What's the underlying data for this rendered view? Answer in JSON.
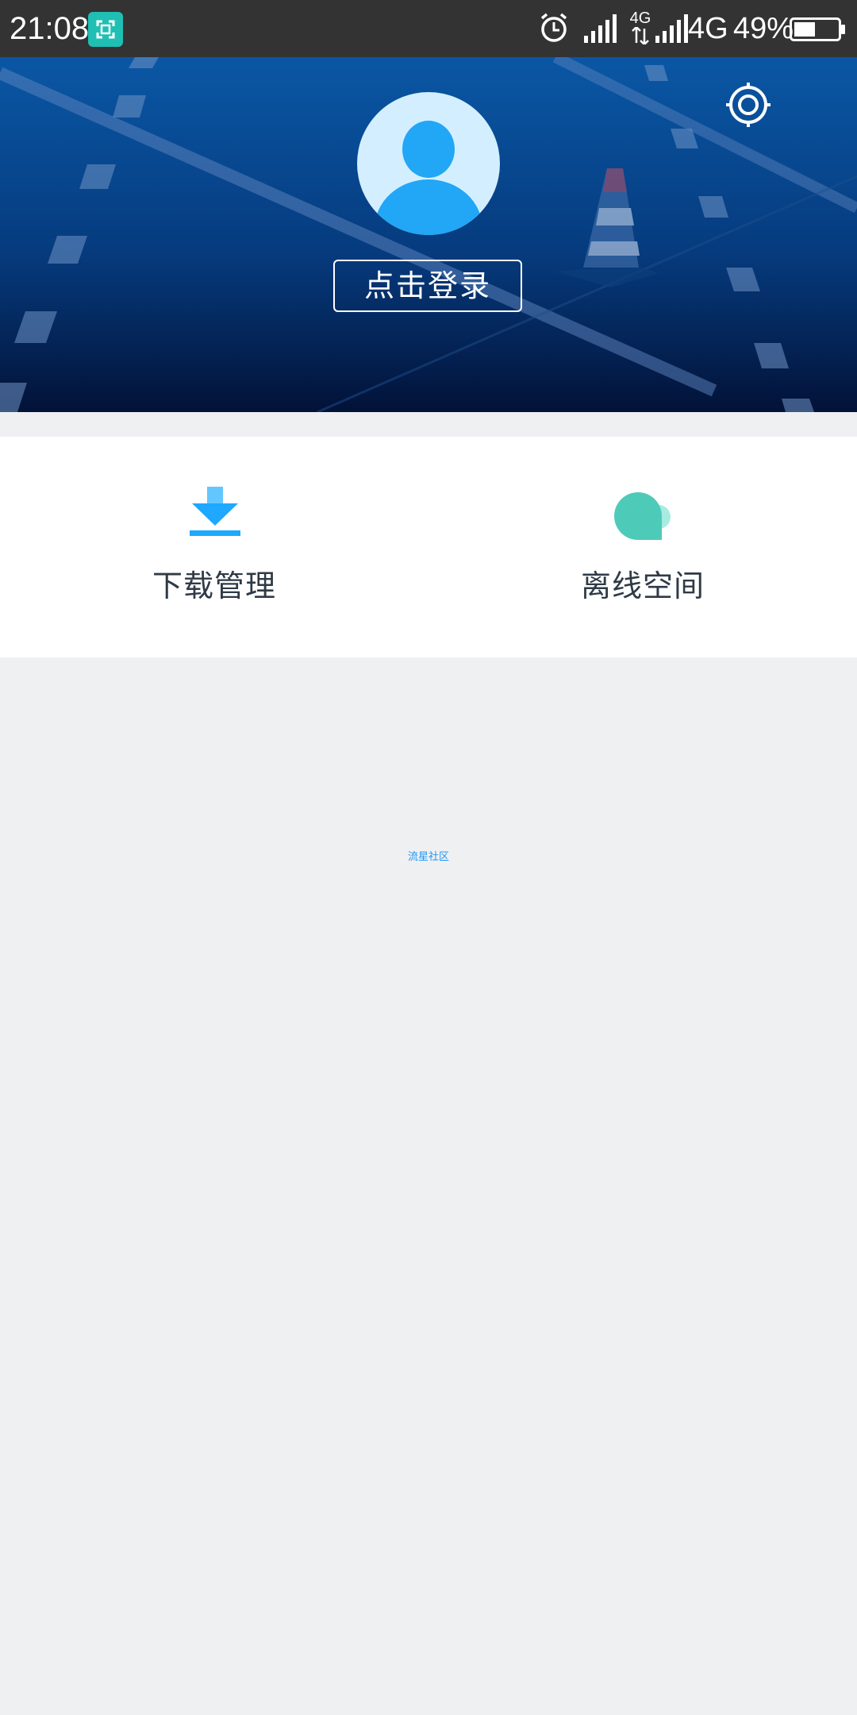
{
  "status_bar": {
    "time": "21:08",
    "network_small": "4G",
    "network": "4G",
    "battery": "49%",
    "battery_level": 0.49,
    "icons": [
      "screen-capture-icon",
      "alarm-icon",
      "signal-icon",
      "data-arrows-icon",
      "signal-icon",
      "battery-icon"
    ]
  },
  "header": {
    "login_button": "点击登录",
    "settings_icon": "gear-icon",
    "avatar_icon": "user-avatar-icon"
  },
  "quick_actions": [
    {
      "label": "下载管理",
      "icon": "download-icon",
      "color": "#1ea8ff"
    },
    {
      "label": "离线空间",
      "icon": "cloud-icon",
      "color": "#4ecbb8"
    }
  ],
  "footer": {
    "link": "流星社区"
  },
  "colors": {
    "status_bar": "#333333",
    "header_top": "#0a57a5",
    "header_bottom": "#021238",
    "background": "#eff0f2",
    "accent": "#1ea8ff"
  }
}
